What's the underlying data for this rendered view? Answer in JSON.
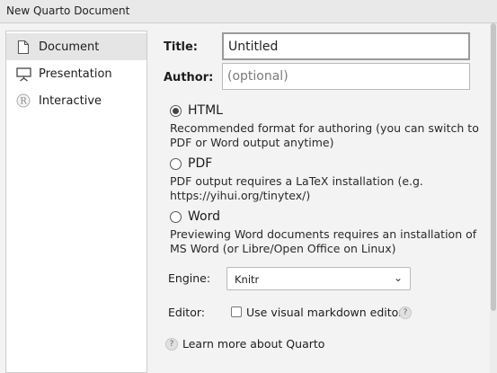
{
  "window": {
    "title": "New Quarto Document"
  },
  "sidebar": {
    "items": [
      {
        "label": "Document",
        "icon": "document-icon",
        "active": true
      },
      {
        "label": "Presentation",
        "icon": "presentation-icon",
        "active": false
      },
      {
        "label": "Interactive",
        "icon": "r-icon",
        "active": false
      }
    ]
  },
  "form": {
    "title_label": "Title:",
    "title_value": "Untitled",
    "author_label": "Author:",
    "author_placeholder": "(optional)",
    "formats": [
      {
        "label": "HTML",
        "checked": true,
        "desc1": "Recommended format for authoring (you can switch to",
        "desc2": "PDF or Word output anytime)"
      },
      {
        "label": "PDF",
        "checked": false,
        "desc1": "PDF output requires a LaTeX installation (e.g.",
        "desc2": "https://yihui.org/tinytex/)"
      },
      {
        "label": "Word",
        "checked": false,
        "desc1": "Previewing Word documents requires an installation of",
        "desc2": "MS Word (or Libre/Open Office on Linux)"
      }
    ],
    "engine_label": "Engine:",
    "engine_value": "Knitr",
    "editor_label": "Editor:",
    "visual_editor_label": "Use visual markdown editor",
    "learn_more": "Learn more about Quarto"
  }
}
